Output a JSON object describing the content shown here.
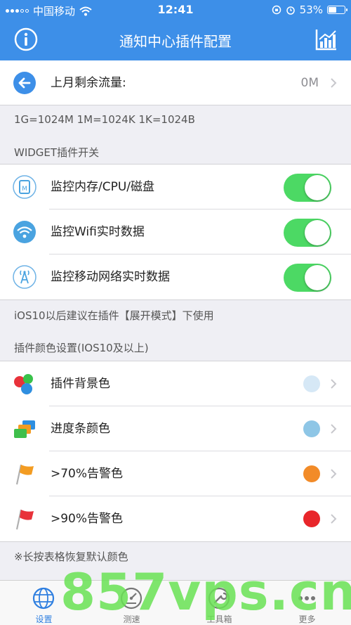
{
  "status": {
    "carrier": "中国移动",
    "time": "12:41",
    "battery": "53%",
    "battery_level": 0.53
  },
  "nav": {
    "title": "通知中心插件配置",
    "left_icon": "info-icon",
    "right_icon": "chart-icon"
  },
  "traffic": {
    "label": "上月剩余流量:",
    "value": "0M",
    "icon": "back-arrow-icon"
  },
  "unit_note": "1G=1024M  1M=1024K  1K=1024B",
  "widget_section": {
    "header": "WIDGET插件开关",
    "items": [
      {
        "label": "监控内存/CPU/磁盘",
        "icon": "memory-icon",
        "on": true
      },
      {
        "label": "监控Wifi实时数据",
        "icon": "wifi-icon",
        "on": true
      },
      {
        "label": "监控移动网络实时数据",
        "icon": "cell-tower-icon",
        "on": true
      }
    ],
    "footer": "iOS10以后建议在插件【展开模式】下使用"
  },
  "color_section": {
    "header": "插件颜色设置(IOS10及以上)",
    "items": [
      {
        "label": "插件背景色",
        "icon": "color-balls-icon",
        "color": "#d6e8f6"
      },
      {
        "label": "进度条颜色",
        "icon": "color-cards-icon",
        "color": "#8ec6e6"
      },
      {
        "label": ">70%告警色",
        "icon": "orange-flag-icon",
        "color": "#f28b28"
      },
      {
        "label": ">90%告警色",
        "icon": "red-flag-icon",
        "color": "#e8262a"
      }
    ],
    "footer": "※长按表格恢复默认颜色"
  },
  "tabs": [
    {
      "label": "设置",
      "icon": "settings-globe-icon",
      "active": true
    },
    {
      "label": "测速",
      "icon": "speedometer-icon",
      "active": false
    },
    {
      "label": "工具箱",
      "icon": "wrench-icon",
      "active": false
    },
    {
      "label": "更多",
      "icon": "more-dots-icon",
      "active": false
    }
  ],
  "watermark": "857vps.cn",
  "colors": {
    "primary": "#3d8fe8",
    "toggle_on": "#4cd964"
  }
}
